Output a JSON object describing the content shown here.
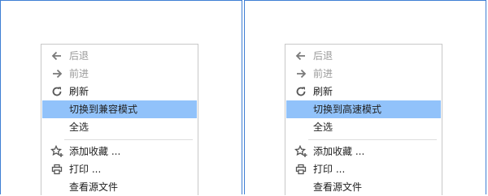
{
  "accent_color": "#3f7fd4",
  "highlight_color": "#91c2fa",
  "menus": [
    {
      "items": [
        {
          "label": "后退",
          "icon": "back-arrow-icon",
          "state": "disabled"
        },
        {
          "label": "前进",
          "icon": "forward-arrow-icon",
          "state": "disabled"
        },
        {
          "label": "刷新",
          "icon": "refresh-icon",
          "state": "enabled"
        },
        {
          "label": "切换到兼容模式",
          "icon": "",
          "state": "highlighted"
        },
        {
          "label": "全选",
          "icon": "",
          "state": "enabled"
        },
        {
          "label": "添加收藏 ...",
          "icon": "add-favorite-star-icon",
          "state": "enabled"
        },
        {
          "label": "打印 ...",
          "icon": "printer-icon",
          "state": "enabled"
        },
        {
          "label": "查看源文件",
          "icon": "",
          "state": "enabled"
        }
      ]
    },
    {
      "items": [
        {
          "label": "后退",
          "icon": "back-arrow-icon",
          "state": "disabled"
        },
        {
          "label": "前进",
          "icon": "forward-arrow-icon",
          "state": "disabled"
        },
        {
          "label": "刷新",
          "icon": "refresh-icon",
          "state": "enabled"
        },
        {
          "label": "切换到高速模式",
          "icon": "",
          "state": "highlighted"
        },
        {
          "label": "全选",
          "icon": "",
          "state": "enabled"
        },
        {
          "label": "添加收藏 ...",
          "icon": "add-favorite-star-icon",
          "state": "enabled"
        },
        {
          "label": "打印 ...",
          "icon": "printer-icon",
          "state": "enabled"
        },
        {
          "label": "查看源文件",
          "icon": "",
          "state": "enabled"
        }
      ]
    }
  ]
}
